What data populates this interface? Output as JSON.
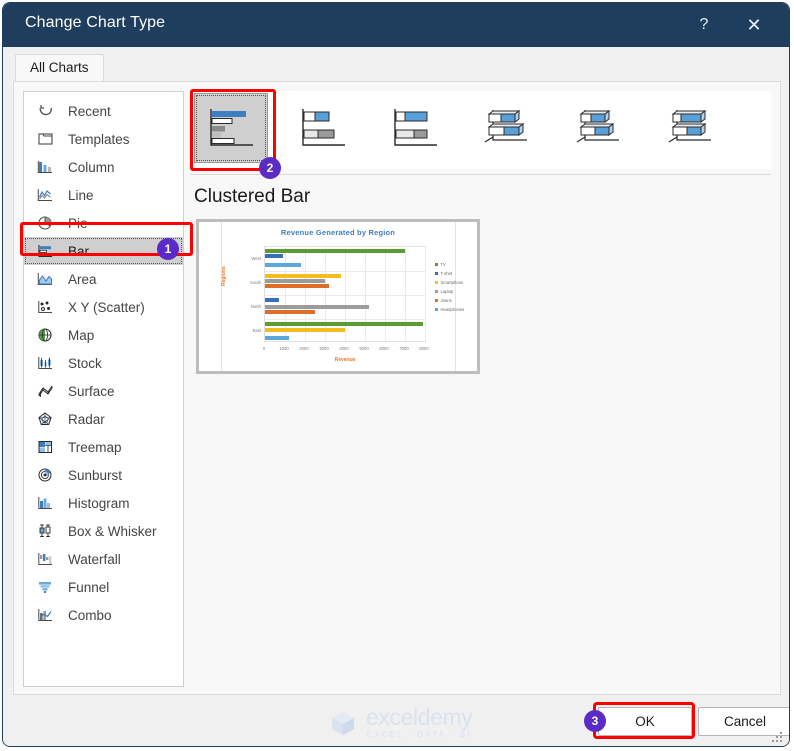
{
  "window": {
    "title": "Change Chart Type",
    "help_label": "?",
    "close_label": "✕"
  },
  "tabs": [
    {
      "label": "All Charts",
      "active": true
    }
  ],
  "sidebar": {
    "items": [
      {
        "label": "Recent",
        "icon": "recent-icon",
        "selected": false
      },
      {
        "label": "Templates",
        "icon": "templates-icon",
        "selected": false
      },
      {
        "label": "Column",
        "icon": "column-icon",
        "selected": false
      },
      {
        "label": "Line",
        "icon": "line-icon",
        "selected": false
      },
      {
        "label": "Pie",
        "icon": "pie-icon",
        "selected": false
      },
      {
        "label": "Bar",
        "icon": "bar-icon",
        "selected": true
      },
      {
        "label": "Area",
        "icon": "area-icon",
        "selected": false
      },
      {
        "label": "X Y (Scatter)",
        "icon": "scatter-icon",
        "selected": false
      },
      {
        "label": "Map",
        "icon": "map-icon",
        "selected": false
      },
      {
        "label": "Stock",
        "icon": "stock-icon",
        "selected": false
      },
      {
        "label": "Surface",
        "icon": "surface-icon",
        "selected": false
      },
      {
        "label": "Radar",
        "icon": "radar-icon",
        "selected": false
      },
      {
        "label": "Treemap",
        "icon": "treemap-icon",
        "selected": false
      },
      {
        "label": "Sunburst",
        "icon": "sunburst-icon",
        "selected": false
      },
      {
        "label": "Histogram",
        "icon": "histogram-icon",
        "selected": false
      },
      {
        "label": "Box & Whisker",
        "icon": "box-whisker-icon",
        "selected": false
      },
      {
        "label": "Waterfall",
        "icon": "waterfall-icon",
        "selected": false
      },
      {
        "label": "Funnel",
        "icon": "funnel-icon",
        "selected": false
      },
      {
        "label": "Combo",
        "icon": "combo-icon",
        "selected": false
      }
    ]
  },
  "thumbnails": [
    {
      "name": "clustered-bar",
      "active": true
    },
    {
      "name": "stacked-bar",
      "active": false
    },
    {
      "name": "100-stacked-bar",
      "active": false
    },
    {
      "name": "3d-clustered-bar",
      "active": false
    },
    {
      "name": "3d-stacked-bar",
      "active": false
    },
    {
      "name": "3d-100-stacked-bar",
      "active": false
    }
  ],
  "preview": {
    "subtitle": "Clustered Bar"
  },
  "chart_data": {
    "type": "bar",
    "orientation": "horizontal",
    "title": "Revenue Generated by Region",
    "xlabel": "Revenue",
    "ylabel": "Regions",
    "categories": [
      "East",
      "North",
      "South",
      "West"
    ],
    "xticks": [
      "0",
      "1000",
      "2000",
      "3000",
      "4000",
      "5000",
      "6000",
      "7000",
      "8000"
    ],
    "xlim": [
      0,
      8000
    ],
    "grid": true,
    "legend_position": "right",
    "series": [
      {
        "name": "TV",
        "color": "#5b9b2f",
        "values": [
          8000,
          0,
          0,
          7000
        ]
      },
      {
        "name": "T-shirt",
        "color": "#3970b5",
        "values": [
          0,
          700,
          0,
          900
        ]
      },
      {
        "name": "Smartphone",
        "color": "#f5bd1f",
        "values": [
          4000,
          0,
          3800,
          0
        ]
      },
      {
        "name": "Laptop",
        "color": "#9c9c9c",
        "values": [
          0,
          5200,
          3000,
          0
        ]
      },
      {
        "name": "Jeans",
        "color": "#e06c2a",
        "values": [
          0,
          2500,
          3200,
          0
        ]
      },
      {
        "name": "Headphones",
        "color": "#59a7dd",
        "values": [
          1200,
          0,
          0,
          1800
        ]
      }
    ]
  },
  "footer": {
    "ok_label": "OK",
    "cancel_label": "Cancel"
  },
  "callouts": [
    {
      "number": "1",
      "target": "sidebar-item-bar"
    },
    {
      "number": "2",
      "target": "thumbnail-clustered-bar"
    },
    {
      "number": "3",
      "target": "ok-button"
    }
  ],
  "watermark": {
    "name": "exceldemy",
    "tagline": "EXCEL · DATA · BI"
  },
  "colors": {
    "titlebar": "#1f3d5c",
    "highlight_red": "#ff0000",
    "callout_purple": "#5b2bc6",
    "chart_title": "#3d7ec1",
    "axis_title": "#e87722"
  }
}
